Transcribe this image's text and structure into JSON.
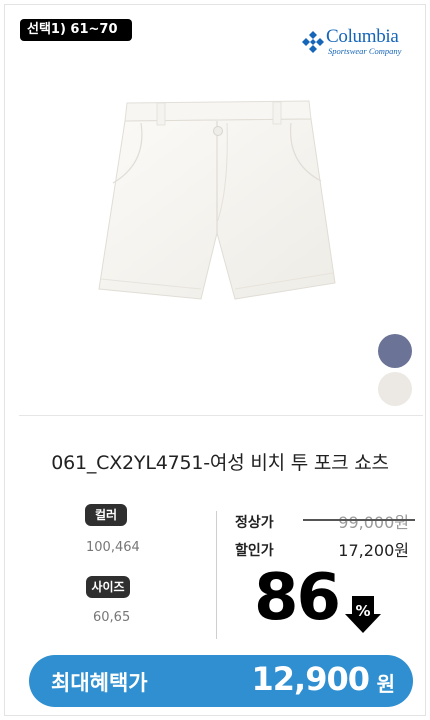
{
  "badge": "선택1) 61~70",
  "brand": {
    "name": "Columbia",
    "sub": "Sportswear Company",
    "color": "#1565b8"
  },
  "product": {
    "title": "061_CX2YL4751-여성 비치 투 포크 쇼츠",
    "image_icon": "white-shorts-image"
  },
  "swatches": [
    {
      "name": "navy-gray",
      "color": "#6b7396"
    },
    {
      "name": "ivory",
      "color": "#ece9e4"
    }
  ],
  "options": {
    "color_label": "컬러",
    "color_values": "100,464",
    "size_label": "사이즈",
    "size_values": "60,65"
  },
  "price": {
    "normal_label": "정상가",
    "normal_value": "99,000원",
    "sale_label": "할인가",
    "sale_value": "17,200원",
    "discount": "86",
    "discount_icon": "percent-down-icon"
  },
  "benefit": {
    "label": "최대혜택가",
    "price": "12,900",
    "unit": "원",
    "color": "#2f8fd0"
  }
}
